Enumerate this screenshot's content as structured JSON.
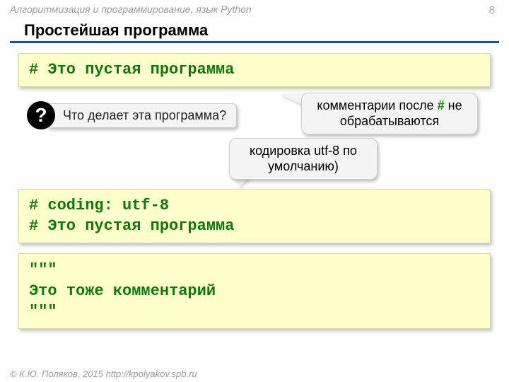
{
  "header": {
    "course": "Алгоритмизация и программирование, язык Python",
    "page_number": "8"
  },
  "title": "Простейшая программа",
  "code1": "# Это пустая программа",
  "question": {
    "mark": "?",
    "text": "Что делает эта программа?"
  },
  "callout_hash": {
    "before": "комментарии после ",
    "hash": "#",
    "after": " не обрабатываются"
  },
  "callout_enc": "кодировка utf-8 по умолчанию)",
  "code2": "# coding: utf-8\n# Это пустая программа",
  "code3": "\"\"\"\nЭто тоже комментарий\n\"\"\"",
  "footer": "© К.Ю. Поляков, 2015  http://kpolyakov.spb.ru"
}
